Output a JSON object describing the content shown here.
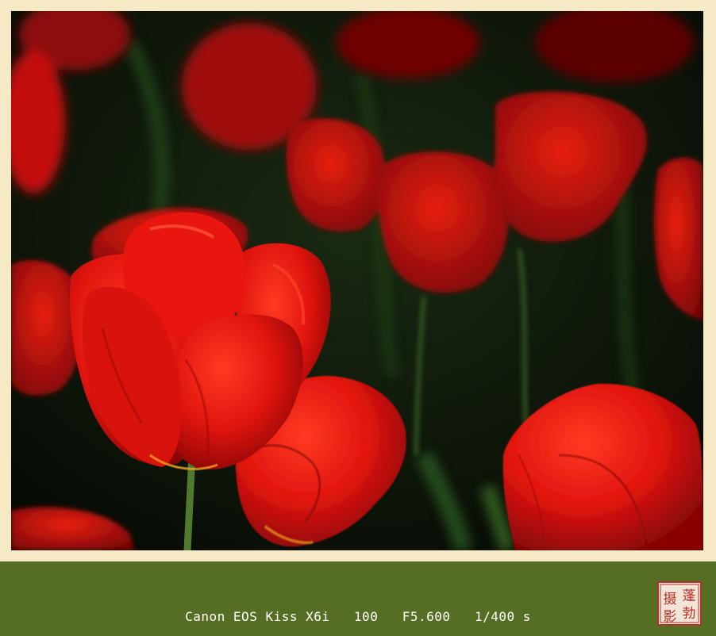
{
  "photo": {
    "subject": "red tulips",
    "colors": {
      "petal": "#e0140e",
      "petal_dark": "#8a0606",
      "foliage": "#1d3a14",
      "background": "#0b1209"
    }
  },
  "caption": {
    "camera": "Canon EOS Kiss X6i",
    "iso": "100",
    "aperture": "F5.600",
    "shutter": "1/400 s"
  },
  "seal": {
    "chars": [
      "蓬",
      "勃",
      "摄",
      "影"
    ],
    "color": "#b5322a"
  },
  "colors": {
    "frame": "#f6e9c6",
    "caption_bar": "#566e23",
    "caption_text": "#ffffff"
  }
}
